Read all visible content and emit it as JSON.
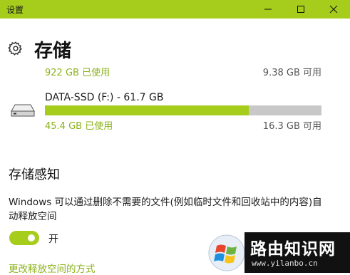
{
  "window": {
    "title": "设置",
    "accent_color": "#a6cc1c",
    "controls": [
      "minimize-icon",
      "maximize-icon",
      "close-icon"
    ]
  },
  "header": {
    "icon": "gear-icon",
    "title": "存储"
  },
  "system_summary": {
    "used": "922 GB 已使用",
    "available": "9.38 GB 可用"
  },
  "drive": {
    "icon": "drive-icon",
    "name": "DATA-SSD (F:) - 61.7 GB",
    "used_fraction": 0.736,
    "used": "45.4 GB 已使用",
    "available": "16.3 GB 可用"
  },
  "storage_sense": {
    "heading": "存储感知",
    "description": "Windows 可以通过删除不需要的文件(例如临时文件和回收站中的内容)自动释放空间",
    "toggle_state": "on",
    "toggle_label": "开",
    "link": "更改释放空间的方式"
  },
  "watermark": {
    "title": "路由知识网",
    "url": "www.yilanbo.cn"
  }
}
